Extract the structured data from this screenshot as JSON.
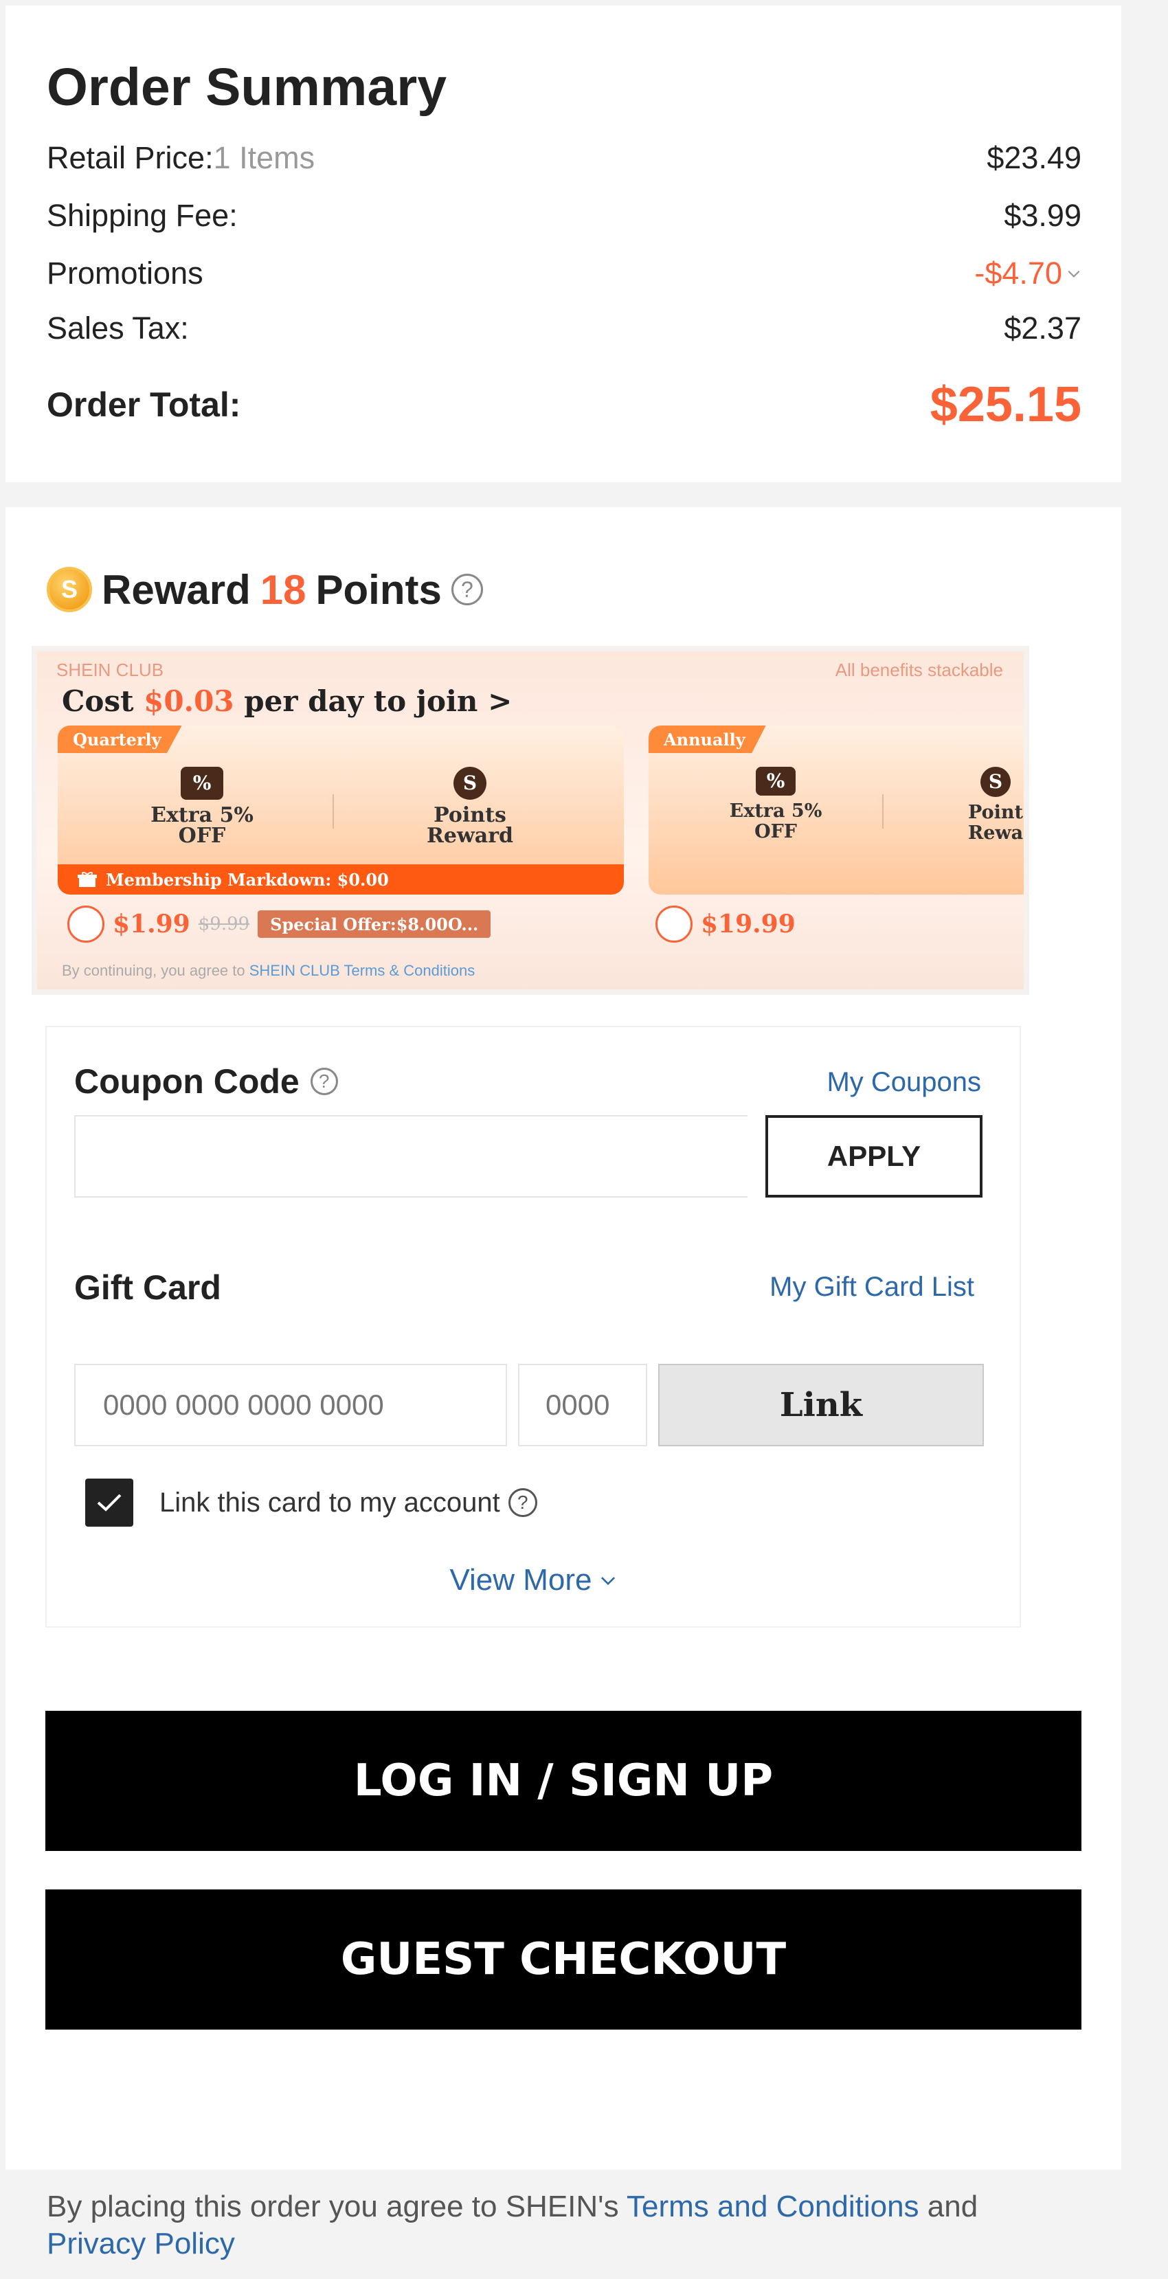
{
  "summary": {
    "title": "Order Summary",
    "retail_label": "Retail Price:",
    "retail_items": "1 Items",
    "retail_value": "$23.49",
    "shipping_label": "Shipping Fee:",
    "shipping_value": "$3.99",
    "promotions_label": "Promotions",
    "promotions_value": "-$4.70",
    "tax_label": "Sales Tax:",
    "tax_value": "$2.37",
    "total_label": "Order Total:",
    "total_value": "$25.15"
  },
  "reward": {
    "coin_glyph": "S",
    "prefix": "Reward",
    "points": "18",
    "suffix": "Points",
    "help_glyph": "?"
  },
  "club": {
    "brand": "SHEIN CLUB",
    "stackable": "All benefits stackable",
    "headline_prefix": "Cost ",
    "headline_price": "$0.03",
    "headline_suffix": " per day to join >",
    "quarterly": {
      "tag": "Quarterly",
      "perk1_icon": "%",
      "perk1_line1": "Extra 5%",
      "perk1_line2": "OFF",
      "perk2_icon": "S",
      "perk2_line1": "Points",
      "perk2_line2": "Reward",
      "markdown": "Membership Markdown: $0.00",
      "price": "$1.99",
      "original": "$9.99",
      "offer": "Special Offer:$8.00O..."
    },
    "annually": {
      "tag": "Annually",
      "perk1_icon": "%",
      "perk1_line1": "Extra 5%",
      "perk1_line2": "OFF",
      "perk2_icon": "S",
      "perk2_line1": "Point",
      "perk2_line2": "Rewa",
      "price": "$19.99"
    },
    "terms_prefix": "By continuing, you agree to ",
    "terms_link": "SHEIN CLUB Terms & Conditions"
  },
  "coupon": {
    "label": "Coupon Code",
    "my_coupons": "My Coupons",
    "input_value": "",
    "apply": "APPLY"
  },
  "gift": {
    "label": "Gift Card",
    "list_link": "My Gift Card List",
    "number_placeholder": "0000 0000 0000 0000",
    "pin_placeholder": "0000",
    "link_button": "Link",
    "link_account": "Link this card to my account",
    "view_more": "View More"
  },
  "buttons": {
    "login": "LOG IN / SIGN UP",
    "guest": "GUEST CHECKOUT"
  },
  "legal": {
    "prefix": "By placing this order you agree to SHEIN's ",
    "terms": "Terms and Conditions",
    "and": " and",
    "privacy": "Privacy Policy"
  },
  "colors": {
    "accent": "#fa6338",
    "link": "#2d68a8",
    "button": "#000000"
  }
}
